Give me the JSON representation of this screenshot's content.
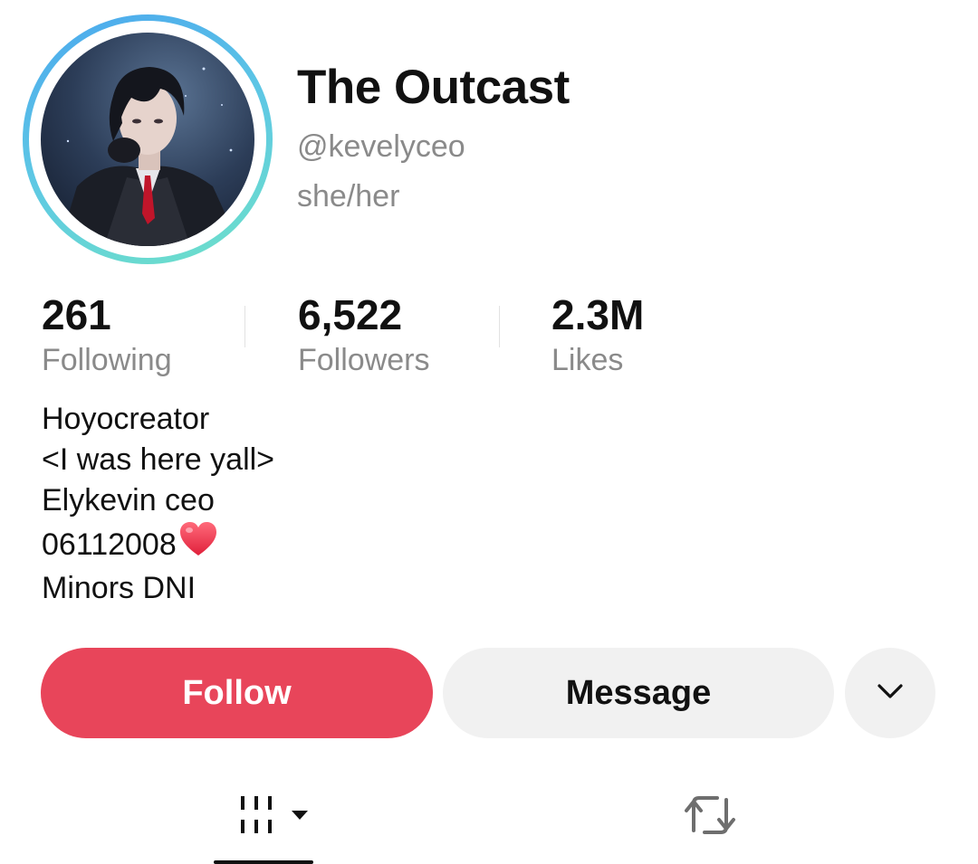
{
  "profile": {
    "display_name": "The Outcast",
    "handle": "@kevelyceo",
    "pronouns": "she/her",
    "avatar_icon": "profile-avatar-anime-character"
  },
  "stats": {
    "following": {
      "value": "261",
      "label": "Following"
    },
    "followers": {
      "value": "6,522",
      "label": "Followers"
    },
    "likes": {
      "value": "2.3M",
      "label": "Likes"
    }
  },
  "bio": {
    "lines": [
      "Hoyocreator",
      "<I was here yall>",
      "Elykevin ceo",
      "06112008",
      "Minors DNI"
    ],
    "emoji_icon": "red-heart-icon"
  },
  "actions": {
    "follow_label": "Follow",
    "message_label": "Message",
    "more_icon": "chevron-down-icon"
  },
  "tabs": {
    "videos_icon": "videos-grid-icon",
    "reposts_icon": "repost-icon",
    "active": "videos"
  },
  "colors": {
    "follow_button": "#e8455a",
    "secondary_button": "#f1f1f1",
    "muted_text": "#8a8a8a",
    "ring_start": "#4aa7ee",
    "ring_end": "#6ee1c8"
  }
}
